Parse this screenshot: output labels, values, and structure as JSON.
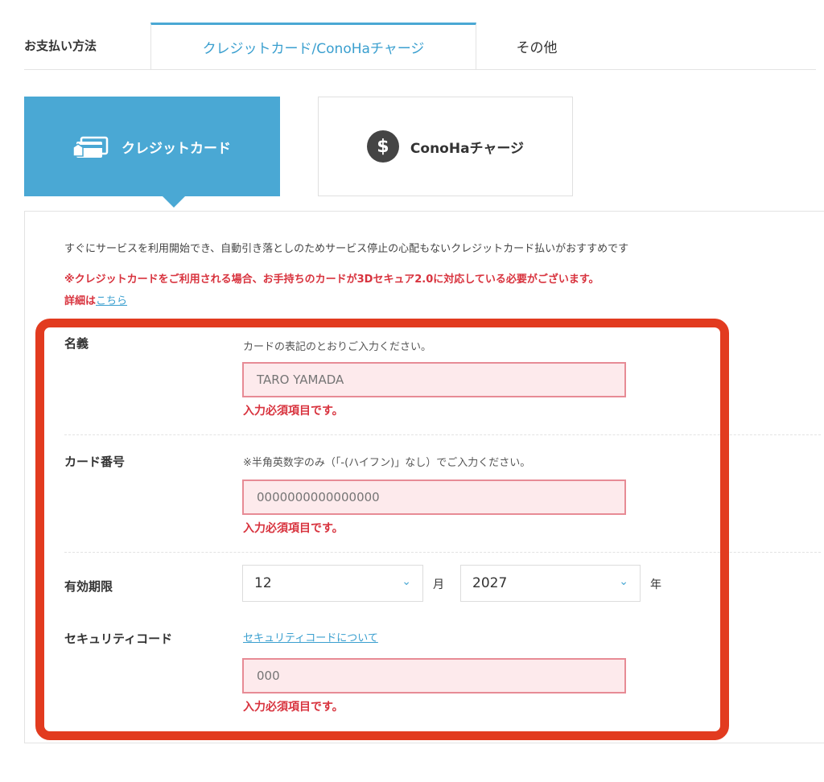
{
  "tabs": {
    "label": "お支払い方法",
    "active": "クレジットカード/ConoHaチャージ",
    "other": "その他"
  },
  "methods": {
    "credit_card": "クレジットカード",
    "conoha_charge": "ConoHaチャージ",
    "dollar_symbol": "$"
  },
  "intro_text": "すぐにサービスを利用開始でき、自動引き落としのためサービス停止の心配もないクレジットカード払いがおすすめです",
  "notice_text": "※クレジットカードをご利用される場合、お手持ちのカードが3Dセキュア2.0に対応している必要がございます。",
  "details": {
    "prefix": "詳細は",
    "link": "こちら"
  },
  "form": {
    "name": {
      "label": "名義",
      "hint": "カードの表記のとおりご入力ください。",
      "placeholder": "TARO YAMADA",
      "error": "入力必須項目です。"
    },
    "card_number": {
      "label": "カード番号",
      "hint": "※半角英数字のみ（「-(ハイフン)」なし）でご入力ください。",
      "placeholder": "0000000000000000",
      "error": "入力必須項目です。"
    },
    "expiry": {
      "label": "有効期限",
      "month_value": "12",
      "month_unit": "月",
      "year_value": "2027",
      "year_unit": "年"
    },
    "security_code": {
      "label": "セキュリティコード",
      "help_link": "セキュリティコードについて",
      "placeholder": "000",
      "error": "入力必須項目です。"
    }
  },
  "colors": {
    "accent": "#4aa8d4",
    "error": "#d8333e",
    "highlight": "#e23b1f",
    "input_bg": "#fdeaec"
  }
}
